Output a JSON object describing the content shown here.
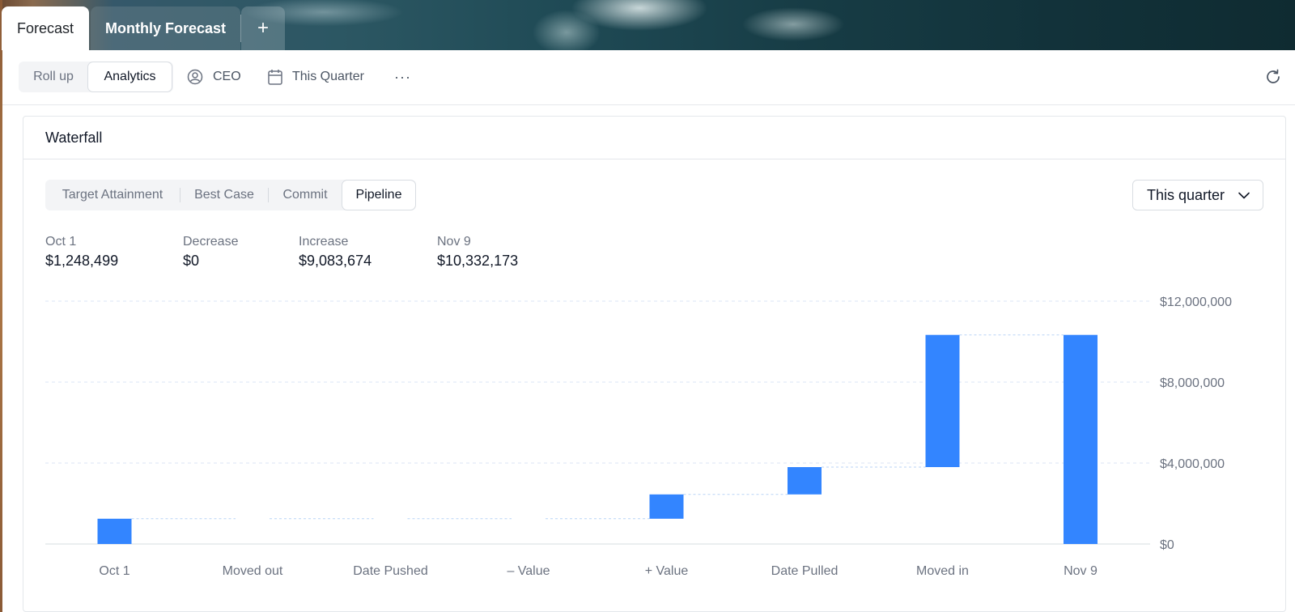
{
  "tabs": [
    {
      "label": "Forecast"
    },
    {
      "label": "Monthly Forecast"
    }
  ],
  "add_tab_label": "+",
  "toolbar": {
    "view_toggle": [
      "Roll up",
      "Analytics"
    ],
    "active_view": "Analytics",
    "user_label": "CEO",
    "period_label": "This Quarter",
    "more_label": "···"
  },
  "card": {
    "title": "Waterfall",
    "metric_tabs": [
      "Target Attainment",
      "Best Case",
      "Commit",
      "Pipeline"
    ],
    "active_metric": "Pipeline",
    "range_select": "This quarter",
    "stats": [
      {
        "label": "Oct 1",
        "value": "$1,248,499"
      },
      {
        "label": "Decrease",
        "value": "$0"
      },
      {
        "label": "Increase",
        "value": "$9,083,674"
      },
      {
        "label": "Nov 9",
        "value": "$10,332,173"
      }
    ]
  },
  "colors": {
    "bar": "#3385ff",
    "grid": "#dbe6f5",
    "connector": "#b9d3f5"
  },
  "chart_data": {
    "type": "bar",
    "subtype": "waterfall",
    "categories": [
      "Oct 1",
      "Moved out",
      "Date Pushed",
      "– Value",
      "+ Value",
      "Date Pulled",
      "Moved in",
      "Nov 9"
    ],
    "ranges": [
      [
        0,
        1248499
      ],
      [
        1248499,
        1248499
      ],
      [
        1248499,
        1248499
      ],
      [
        1248499,
        1248499
      ],
      [
        1248499,
        2450000
      ],
      [
        2450000,
        3800000
      ],
      [
        3800000,
        10332173
      ],
      [
        0,
        10332173
      ]
    ],
    "y_ticks": [
      0,
      4000000,
      8000000,
      12000000
    ],
    "y_tick_labels": [
      "$0",
      "$4,000,000",
      "$8,000,000",
      "$12,000,000"
    ],
    "ylim": [
      0,
      12000000
    ],
    "grid": true,
    "y_axis_side": "right"
  }
}
